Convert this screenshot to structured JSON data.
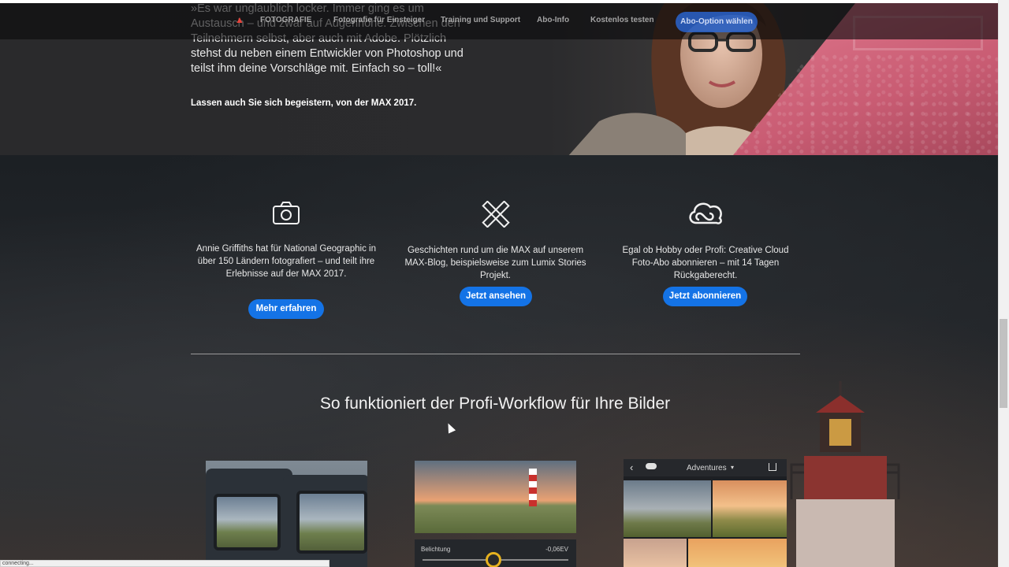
{
  "hero": {
    "quote": "»Es war unglaublich locker. Immer ging es um Austausch – und zwar auf Augenhöhe. Zwischen den Teilnehmern selbst, aber auch mit Adobe. Plötzlich stehst du neben einem Entwickler von Photoshop und teilst ihm deine Vorschläge mit. Einfach so – toll!«",
    "cta": "Lassen auch Sie sich begeistern, von der MAX 2017."
  },
  "nav": {
    "brand": "FOTOGRAFIE",
    "links": [
      "Fotografie für Einsteiger",
      "Training und Support",
      "Abo-Info",
      "Kostenlos testen"
    ],
    "cta": "Abo-Option wählen"
  },
  "features": [
    {
      "icon": "camera-icon",
      "text": "Annie Griffiths hat für National Geographic in über 150 Ländern fotografiert – und teilt ihre Erlebnisse auf der MAX 2017.",
      "button": "Mehr erfahren"
    },
    {
      "icon": "pencil-ruler-icon",
      "text": "Geschichten rund um die MAX auf unserem MAX-Blog, beispielsweise zum Lumix Stories Projekt.",
      "button": "Jetzt ansehen"
    },
    {
      "icon": "creative-cloud-icon",
      "text": "Egal ob Hobby oder Profi: Creative Cloud Foto-Abo abonnieren – mit 14 Tagen Rückgaberecht.",
      "button": "Jetzt abonnieren"
    }
  ],
  "workflow": {
    "title": "So funktioniert der Profi-Workflow für Ihre Bilder",
    "slider_label": "Belichtung",
    "slider_value": "-0,06EV",
    "album_title": "Adventures"
  },
  "status": "connecting..."
}
